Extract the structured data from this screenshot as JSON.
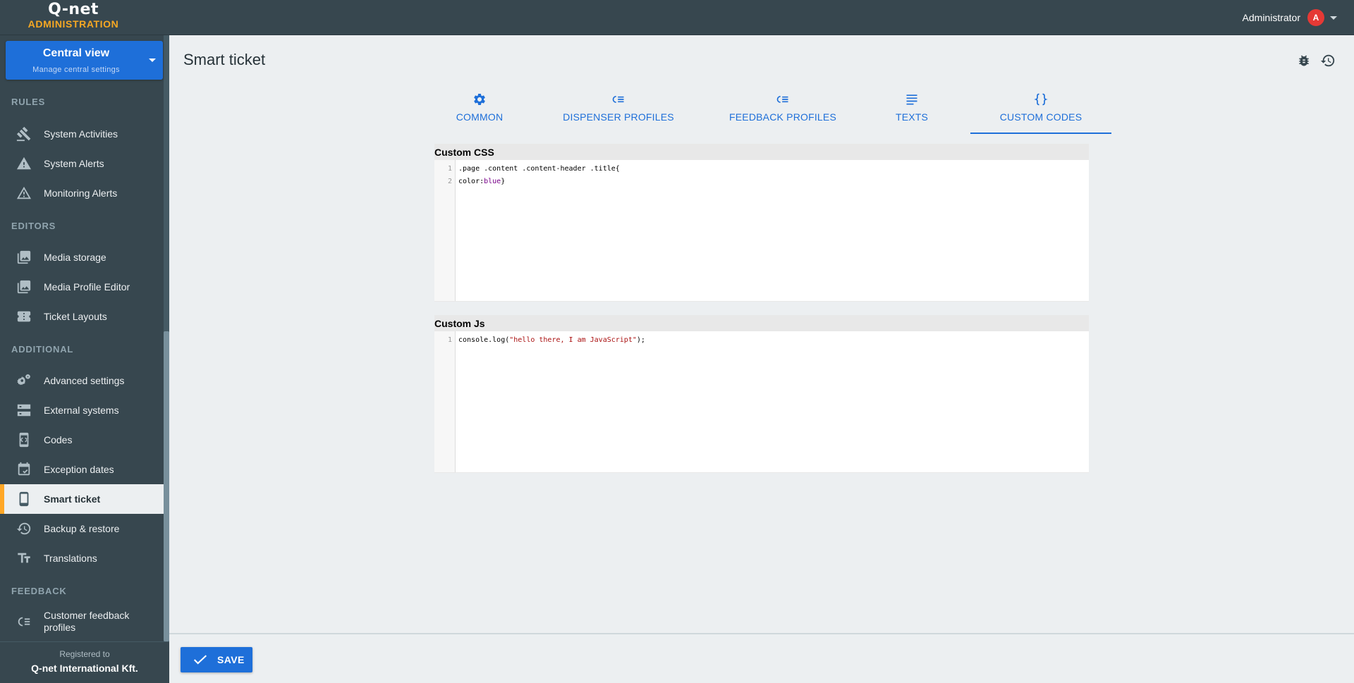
{
  "app": {
    "logo_word": "Q-net",
    "logo_sub": "ADMINISTRATION"
  },
  "user": {
    "name": "Administrator",
    "avatar_letter": "A",
    "avatar_color": "#e53935"
  },
  "view_selector": {
    "title": "Central view",
    "subtitle": "Manage central settings"
  },
  "sidebar": {
    "sections": {
      "rules": "RULES",
      "editors": "EDITORS",
      "additional": "ADDITIONAL",
      "feedback": "FEEDBACK"
    },
    "items": [
      {
        "label": "System Activities",
        "icon": "gavel-icon"
      },
      {
        "label": "System Alerts",
        "icon": "warning-icon"
      },
      {
        "label": "Monitoring Alerts",
        "icon": "warning-outline-icon"
      },
      {
        "label": "Media storage",
        "icon": "photo-library-icon"
      },
      {
        "label": "Media Profile Editor",
        "icon": "photo-library-icon"
      },
      {
        "label": "Ticket Layouts",
        "icon": "ticket-icon"
      },
      {
        "label": "Advanced settings",
        "icon": "gears-icon"
      },
      {
        "label": "External systems",
        "icon": "servers-icon"
      },
      {
        "label": "Codes",
        "icon": "code-icon"
      },
      {
        "label": "Exception dates",
        "icon": "calendar-icon"
      },
      {
        "label": "Smart ticket",
        "icon": "smartphone-icon",
        "active": true
      },
      {
        "label": "Backup & restore",
        "icon": "restore-icon"
      },
      {
        "label": "Translations",
        "icon": "text-size-icon"
      },
      {
        "label": "Customer feedback profiles",
        "icon": "feedback-list-icon"
      }
    ],
    "registered_label": "Registered to",
    "registered_org": "Q-net International Kft."
  },
  "page": {
    "title": "Smart ticket"
  },
  "tabs": [
    {
      "label": "COMMON",
      "icon": "gear-icon"
    },
    {
      "label": "DISPENSER PROFILES",
      "icon": "list-icon"
    },
    {
      "label": "FEEDBACK PROFILES",
      "icon": "list-icon"
    },
    {
      "label": "TEXTS",
      "icon": "lines-icon"
    },
    {
      "label": "CUSTOM CODES",
      "icon": "braces-icon",
      "active": true
    }
  ],
  "custom_css": {
    "label": "Custom CSS",
    "lines": [
      {
        "num": "1",
        "text": ".page .content .content-header .title{"
      },
      {
        "num": "2",
        "prefix": "color:",
        "value": "blue",
        "suffix": "}"
      }
    ]
  },
  "custom_js": {
    "label": "Custom Js",
    "lines": [
      {
        "num": "1",
        "prefix": "console.log(",
        "string": "\"hello there, I am JavaScript\"",
        "suffix": ");"
      }
    ]
  },
  "footer": {
    "save_label": "SAVE"
  },
  "colors": {
    "primary": "#1e6fd9",
    "sidebar_bg": "#37474f",
    "accent": "#ffa726",
    "brand_orange": "#f7a823"
  }
}
